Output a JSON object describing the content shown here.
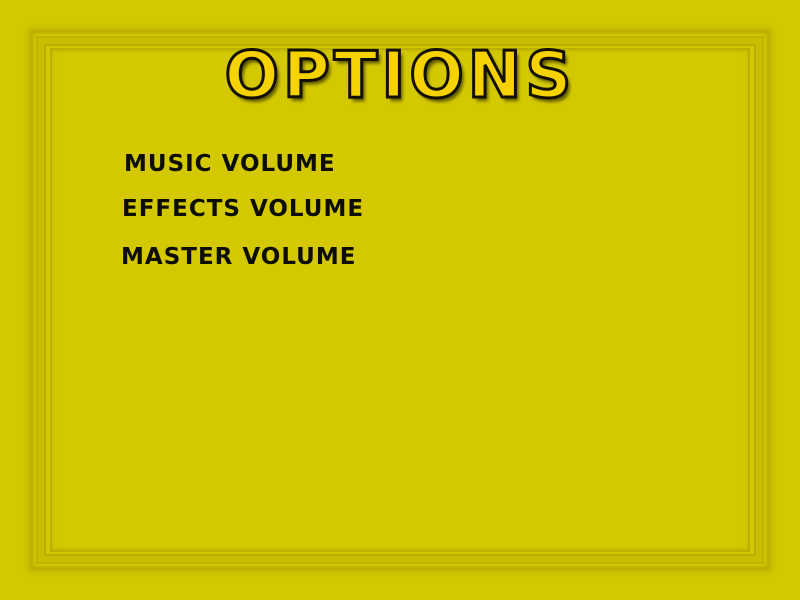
{
  "screen": {
    "title": "OPTIONS",
    "background_color": "#d4c900",
    "title_color": "#f5d200"
  },
  "menu": {
    "items": [
      {
        "label": "Music Volume"
      },
      {
        "label": "Effects Volume"
      },
      {
        "label": "Master Volume"
      }
    ]
  }
}
